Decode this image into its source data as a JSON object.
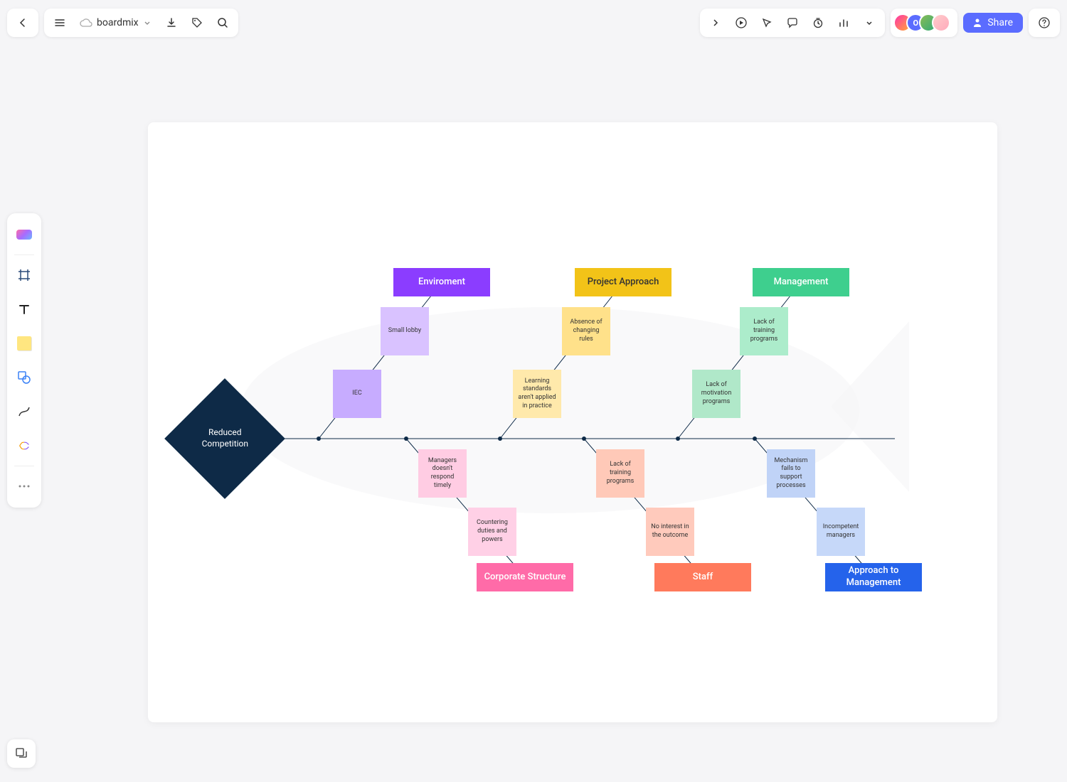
{
  "header": {
    "board_name": "boardmix",
    "share_label": "Share",
    "avatar_initial": "O"
  },
  "toolbar_icons": {
    "back": "back-icon",
    "menu": "menu-icon",
    "download": "download-icon",
    "tag": "tag-icon",
    "search": "search-icon",
    "expand": "expand-icon",
    "play": "play-icon",
    "cursor": "cursor-icon",
    "comment": "comment-icon",
    "timer": "timer-icon",
    "chart": "chart-icon",
    "more": "more-icon",
    "help": "help-icon"
  },
  "diagram": {
    "head": "Reduced Competition",
    "top_branches": [
      {
        "category": "Enviroment",
        "category_color": "#8b3dff",
        "causes": [
          {
            "text": "Small lobby",
            "color": "#d9c2ff"
          },
          {
            "text": "IEC",
            "color": "#c7acff"
          }
        ]
      },
      {
        "category": "Project Approach",
        "category_color": "#f2c318",
        "category_text_color": "#333",
        "causes": [
          {
            "text": "Absence of changing rules",
            "color": "#ffe18a"
          },
          {
            "text": "Learning standards aren't applied in practice",
            "color": "#ffe9ab"
          }
        ]
      },
      {
        "category": "Management",
        "category_color": "#3ecf8e",
        "causes": [
          {
            "text": "Lack of training programs",
            "color": "#aceccb"
          },
          {
            "text": "Lack of motivation programs",
            "color": "#b0e8c9"
          }
        ]
      }
    ],
    "bottom_branches": [
      {
        "category": "Corporate Structure",
        "category_color": "#ff6ba8",
        "causes": [
          {
            "text": "Managers doesn't respond timely",
            "color": "#ffcce3"
          },
          {
            "text": "Countering duties and powers",
            "color": "#ffd0e6"
          }
        ]
      },
      {
        "category": "Staff",
        "category_color": "#ff7a5c",
        "causes": [
          {
            "text": "Lack of training programs",
            "color": "#ffc9b8"
          },
          {
            "text": "No interest in the outcome",
            "color": "#ffcabc"
          }
        ]
      },
      {
        "category": "Approach to Management",
        "category_color": "#2563eb",
        "causes": [
          {
            "text": "Mechanism fails to support processes",
            "color": "#c0d3f7"
          },
          {
            "text": "Incompetent managers",
            "color": "#c6d8f9"
          }
        ]
      }
    ]
  }
}
